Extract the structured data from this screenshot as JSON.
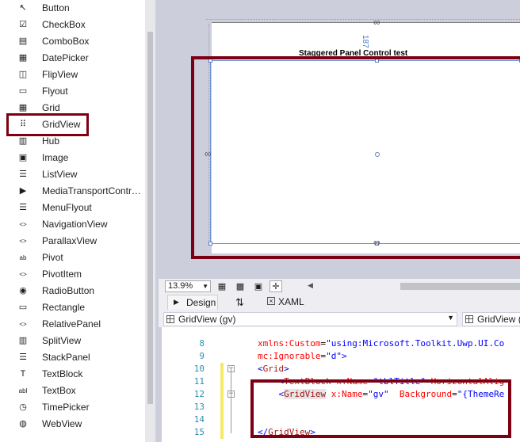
{
  "toolbox": {
    "items": [
      {
        "label": "Button",
        "icon": "pointer-icon",
        "glyph": "↖"
      },
      {
        "label": "CheckBox",
        "icon": "checkbox-icon",
        "glyph": "☑"
      },
      {
        "label": "ComboBox",
        "icon": "combobox-icon",
        "glyph": "▤"
      },
      {
        "label": "DatePicker",
        "icon": "calendar-icon",
        "glyph": "▦"
      },
      {
        "label": "FlipView",
        "icon": "flipview-icon",
        "glyph": "◫"
      },
      {
        "label": "Flyout",
        "icon": "flyout-icon",
        "glyph": "▭"
      },
      {
        "label": "Grid",
        "icon": "grid-icon",
        "glyph": "▦"
      },
      {
        "label": "GridView",
        "icon": "gridview-icon",
        "glyph": "⠿"
      },
      {
        "label": "Hub",
        "icon": "hub-icon",
        "glyph": "▥"
      },
      {
        "label": "Image",
        "icon": "image-icon",
        "glyph": "▣"
      },
      {
        "label": "ListView",
        "icon": "listview-icon",
        "glyph": "☰"
      },
      {
        "label": "MediaTransportContr…",
        "icon": "media-transport-icon",
        "glyph": "▶"
      },
      {
        "label": "MenuFlyout",
        "icon": "menuflyout-icon",
        "glyph": "☰"
      },
      {
        "label": "NavigationView",
        "icon": "code-brackets-icon",
        "glyph": "<>"
      },
      {
        "label": "ParallaxView",
        "icon": "code-brackets-icon",
        "glyph": "<>"
      },
      {
        "label": "Pivot",
        "icon": "pivot-icon",
        "glyph": "ab"
      },
      {
        "label": "PivotItem",
        "icon": "code-brackets-icon",
        "glyph": "<>"
      },
      {
        "label": "RadioButton",
        "icon": "radio-icon",
        "glyph": "◉"
      },
      {
        "label": "Rectangle",
        "icon": "rectangle-icon",
        "glyph": "▭"
      },
      {
        "label": "RelativePanel",
        "icon": "code-brackets-icon",
        "glyph": "<>"
      },
      {
        "label": "SplitView",
        "icon": "splitview-icon",
        "glyph": "▥"
      },
      {
        "label": "StackPanel",
        "icon": "stackpanel-icon",
        "glyph": "☰"
      },
      {
        "label": "TextBlock",
        "icon": "textblock-icon",
        "glyph": "T"
      },
      {
        "label": "TextBox",
        "icon": "textbox-icon",
        "glyph": "abl"
      },
      {
        "label": "TimePicker",
        "icon": "clock-icon",
        "glyph": "◷"
      },
      {
        "label": "WebView",
        "icon": "globe-icon",
        "glyph": "◍"
      }
    ]
  },
  "designer": {
    "page_title": "Staggered Panel Control test",
    "margin_value": "187"
  },
  "design_toolbar": {
    "zoom": "13.9%"
  },
  "tabs": {
    "design": "Design",
    "xaml": "XAML",
    "swap_glyph": "⇅"
  },
  "nav": {
    "left_dropdown": "GridView (gv)",
    "right_dropdown": "GridView ("
  },
  "editor": {
    "lines": [
      {
        "num": "",
        "code": [
          {
            "t": "            ",
            "c": "plain"
          }
        ]
      },
      {
        "num": "8",
        "code": [
          {
            "t": "xmlns:Custom",
            "c": "attr"
          },
          {
            "t": "=",
            "c": "plain"
          },
          {
            "t": "\"using:Microsoft.Toolkit.Uwp.UI.Co",
            "c": "val"
          }
        ]
      },
      {
        "num": "9",
        "code": [
          {
            "t": "mc:Ignorable",
            "c": "attr"
          },
          {
            "t": "=",
            "c": "plain"
          },
          {
            "t": "\"d\"",
            "c": "val"
          },
          {
            "t": ">",
            "c": "br"
          }
        ]
      },
      {
        "num": "10",
        "code": [
          {
            "t": "<",
            "c": "br"
          },
          {
            "t": "Grid",
            "c": "tag"
          },
          {
            "t": ">",
            "c": "br"
          }
        ]
      },
      {
        "num": "11",
        "code": [
          {
            "t": "    <",
            "c": "br"
          },
          {
            "t": "TextBlock",
            "c": "tag"
          },
          {
            "t": " x:Name",
            "c": "attr"
          },
          {
            "t": "=",
            "c": "plain"
          },
          {
            "t": "\"tblTitle\"",
            "c": "val"
          },
          {
            "t": " HorizontalAlig",
            "c": "attr"
          }
        ]
      },
      {
        "num": "12",
        "code": [
          {
            "t": "    <",
            "c": "br"
          },
          {
            "t": "GridView",
            "c": "tag"
          },
          {
            "t": " x:Name",
            "c": "attr"
          },
          {
            "t": "=",
            "c": "plain"
          },
          {
            "t": "\"gv\"",
            "c": "val"
          },
          {
            "t": "  Background",
            "c": "attr"
          },
          {
            "t": "=",
            "c": "plain"
          },
          {
            "t": "\"{ThemeRe",
            "c": "val"
          }
        ]
      },
      {
        "num": "13",
        "code": [
          {
            "t": "",
            "c": "plain"
          }
        ]
      },
      {
        "num": "14",
        "code": [
          {
            "t": "",
            "c": "plain"
          }
        ]
      },
      {
        "num": "15",
        "code": [
          {
            "t": "</",
            "c": "br"
          },
          {
            "t": "GridView",
            "c": "tag"
          },
          {
            "t": ">",
            "c": "br"
          }
        ]
      }
    ]
  },
  "colors": {
    "annotation_red": "#7b0014",
    "selection_blue": "#6a8fd4",
    "changed_line_yellow": "#f5e96a"
  }
}
